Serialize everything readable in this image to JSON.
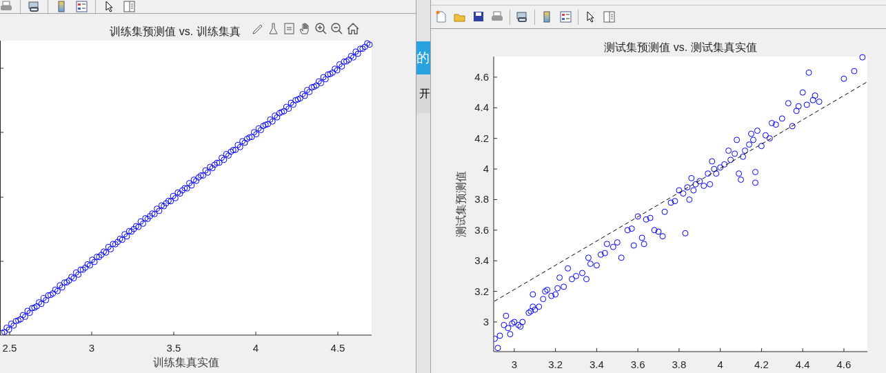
{
  "left_figure": {
    "title": "训练集预测值 vs. 训练集真",
    "x_tick_labels": [
      "2.5",
      "3",
      "3.5",
      "4",
      "4.5"
    ],
    "xlabel": "训练集真实值"
  },
  "background_app": {
    "band_text": "的",
    "row_text": "开"
  },
  "right_figure": {
    "title": "测试集预测值 vs. 测试集真实值",
    "chart_data": {
      "type": "scatter",
      "ylabel": "测试集预测值",
      "xlim": [
        2.9,
        4.714
      ],
      "ylim": [
        2.806,
        4.735
      ],
      "xticks": [
        3,
        3.2,
        3.4,
        3.6,
        3.8,
        4,
        4.2,
        4.4,
        4.6
      ],
      "yticks": [
        3,
        3.2,
        3.4,
        3.6,
        3.8,
        4,
        4.2,
        4.4,
        4.6
      ],
      "series": [
        {
          "color": "#0000ff",
          "x": [
            2.905,
            2.92,
            2.93,
            2.95,
            2.96,
            2.97,
            2.98,
            2.99,
            3.0,
            3.02,
            3.03,
            3.04,
            3.07,
            3.08,
            3.09,
            3.09,
            3.1,
            3.12,
            3.14,
            3.15,
            3.16,
            3.18,
            3.2,
            3.21,
            3.22,
            3.24,
            3.26,
            3.28,
            3.3,
            3.33,
            3.35,
            3.36,
            3.37,
            3.4,
            3.42,
            3.44,
            3.45,
            3.48,
            3.5,
            3.52,
            3.55,
            3.57,
            3.58,
            3.6,
            3.62,
            3.63,
            3.64,
            3.66,
            3.68,
            3.7,
            3.72,
            3.73,
            3.76,
            3.78,
            3.8,
            3.82,
            3.83,
            3.84,
            3.85,
            3.86,
            3.87,
            3.88,
            3.9,
            3.92,
            3.94,
            3.95,
            3.96,
            3.97,
            3.98,
            4.0,
            4.02,
            4.04,
            4.05,
            4.07,
            4.08,
            4.09,
            4.1,
            4.11,
            4.12,
            4.14,
            4.15,
            4.16,
            4.17,
            4.17,
            4.18,
            4.2,
            4.22,
            4.24,
            4.25,
            4.27,
            4.3,
            4.33,
            4.35,
            4.37,
            4.38,
            4.4,
            4.42,
            4.43,
            4.45,
            4.46,
            4.48,
            4.6,
            4.65,
            4.69
          ],
          "values": [
            2.89,
            2.83,
            2.91,
            2.98,
            3.04,
            2.96,
            2.92,
            2.99,
            3.0,
            2.98,
            2.97,
            3.0,
            3.06,
            3.07,
            3.1,
            3.18,
            3.08,
            3.1,
            3.15,
            3.2,
            3.21,
            3.17,
            3.18,
            3.22,
            3.29,
            3.23,
            3.35,
            3.28,
            3.3,
            3.32,
            3.28,
            3.42,
            3.38,
            3.37,
            3.44,
            3.45,
            3.51,
            3.49,
            3.52,
            3.42,
            3.6,
            3.61,
            3.5,
            3.69,
            3.55,
            3.51,
            3.67,
            3.68,
            3.6,
            3.59,
            3.56,
            3.72,
            3.78,
            3.79,
            3.86,
            3.84,
            3.58,
            3.88,
            3.8,
            3.94,
            3.86,
            3.9,
            3.92,
            3.89,
            3.97,
            3.9,
            4.05,
            4.0,
            3.97,
            4.01,
            4.03,
            4.12,
            4.06,
            4.1,
            4.19,
            3.97,
            3.93,
            4.08,
            4.12,
            4.16,
            4.23,
            4.19,
            3.91,
            3.98,
            4.25,
            4.15,
            4.22,
            4.2,
            4.3,
            4.29,
            4.33,
            4.43,
            4.28,
            4.38,
            4.41,
            4.5,
            4.42,
            4.63,
            4.45,
            4.48,
            4.44,
            4.59,
            4.64,
            4.73
          ]
        },
        {
          "type": "line",
          "line_style": "dashed",
          "color": "#000000",
          "x": [
            2.903,
            4.714
          ],
          "values": [
            3.135,
            4.57
          ]
        }
      ]
    }
  }
}
